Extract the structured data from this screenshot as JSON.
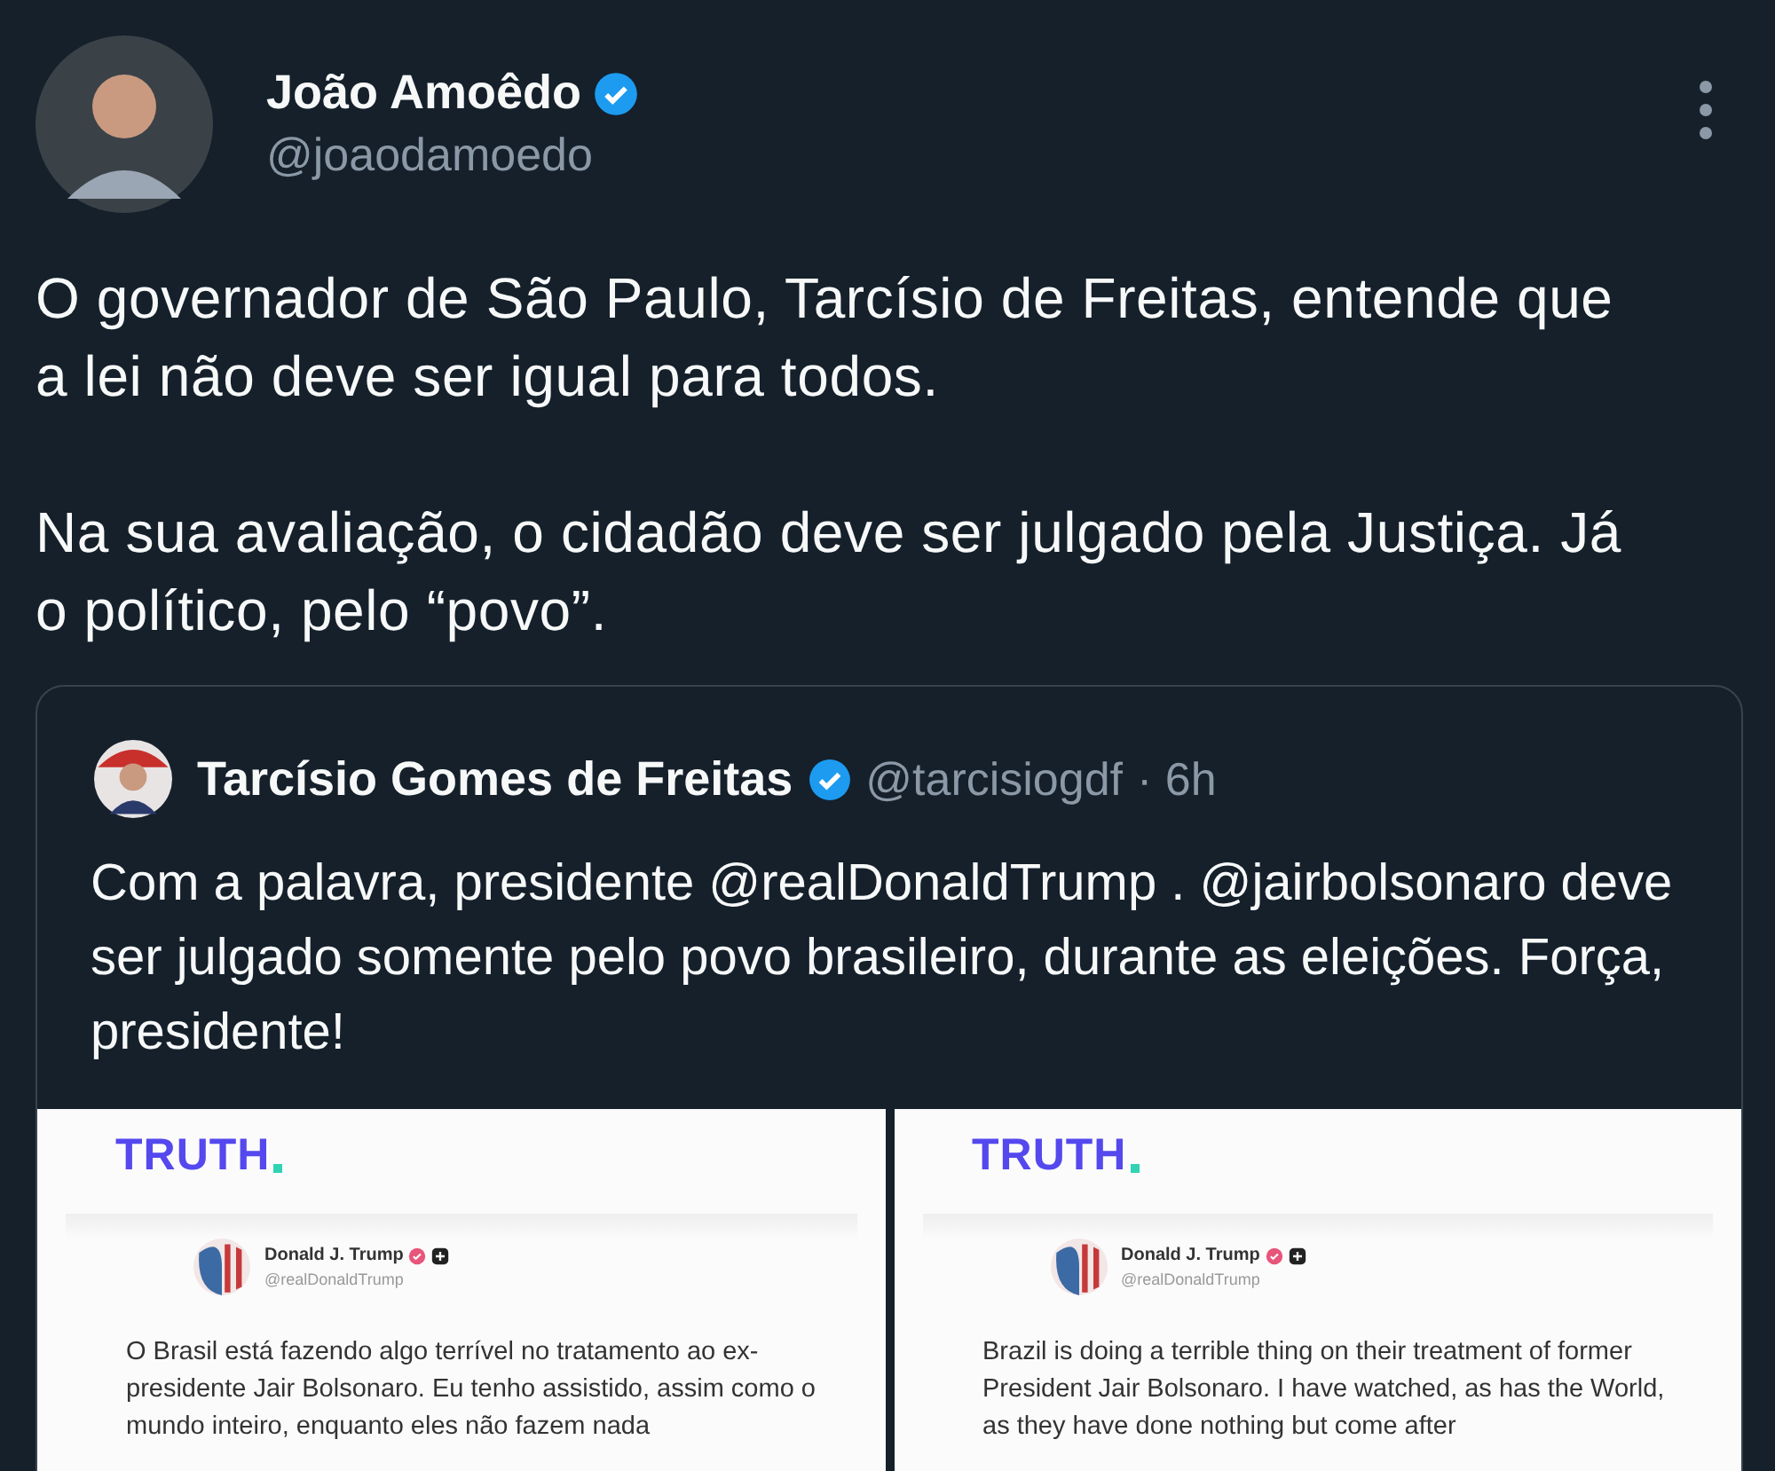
{
  "author": {
    "name": "João Amoêdo",
    "verified": true,
    "handle": "@joaodamoedo"
  },
  "body": [
    "O governador de São Paulo, Tarcísio de Freitas, entende que a lei não deve ser igual para todos.",
    "Na sua avaliação, o cidadão deve ser julgado pela Justiça. Já o político, pelo “povo”."
  ],
  "quote": {
    "name": "Tarcísio Gomes de Freitas",
    "verified": true,
    "handle": "@tarcisiogdf",
    "time": "· 6h",
    "text": "Com a palavra, presidente @realDonaldTrump . @jairbolsonaro deve ser julgado somente pelo povo brasileiro, durante as eleições. Força, presidente!",
    "images": [
      {
        "logo": "TRUTH",
        "name": "Donald J. Trump",
        "handle": "@realDonaldTrump",
        "text": "O Brasil está fazendo algo terrível no tratamento ao ex-presidente Jair Bolsonaro. Eu tenho assistido, assim como o mundo inteiro, enquanto eles não fazem nada"
      },
      {
        "logo": "TRUTH",
        "name": "Donald J. Trump",
        "handle": "@realDonaldTrump",
        "text": "Brazil is doing a terrible thing on their treatment of former President Jair Bolsonaro. I have watched, as has the World, as they have done nothing but come after"
      }
    ]
  }
}
